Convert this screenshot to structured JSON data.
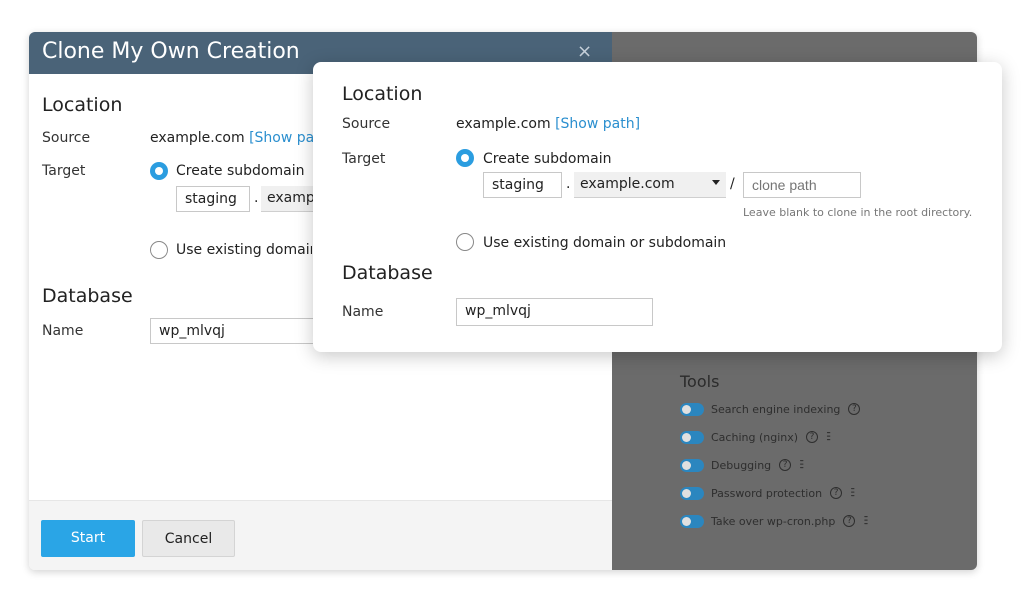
{
  "dialog": {
    "title": "Clone My Own Creation",
    "close_symbol": "×",
    "location_heading": "Location",
    "source_label": "Source",
    "source_value": "example.com",
    "show_path_link": "[Show path]",
    "target_label": "Target",
    "create_subdomain_label": "Create subdomain",
    "subdomain_value": "staging",
    "dot_separator": ".",
    "domain_partial": "example.com",
    "existing_domain_label": "Use existing domain or subdomain",
    "database_heading": "Database",
    "name_label": "Name",
    "db_name_value": "wp_mlvqj",
    "start_button": "Start",
    "cancel_button": "Cancel"
  },
  "tools": {
    "title": "Tools",
    "items": [
      {
        "label": "Search engine indexing",
        "has_settings": false
      },
      {
        "label": "Caching (nginx)",
        "has_settings": true
      },
      {
        "label": "Debugging",
        "has_settings": true
      },
      {
        "label": "Password protection",
        "has_settings": true
      },
      {
        "label": "Take over wp-cron.php",
        "has_settings": true
      }
    ],
    "help_symbol": "?",
    "settings_symbol": "⫶⫶⫶"
  },
  "card": {
    "location_heading": "Location",
    "source_label": "Source",
    "source_value": "example.com",
    "show_path_link": "[Show path]",
    "target_label": "Target",
    "create_subdomain_label": "Create subdomain",
    "subdomain_value": "staging",
    "dot_separator": ".",
    "domain_select_value": "example.com",
    "slash_separator": "/",
    "clone_path_placeholder": "clone path",
    "clone_path_hint": "Leave blank to clone in the root directory.",
    "existing_domain_label": "Use existing domain or subdomain",
    "database_heading": "Database",
    "name_label": "Name",
    "db_name_value": "wp_mlvqj"
  },
  "colors": {
    "header_bg": "#4a6378",
    "accent": "#2aa5e6",
    "link": "#2b8fcf",
    "overlay_panel": "#6b6b6b"
  }
}
